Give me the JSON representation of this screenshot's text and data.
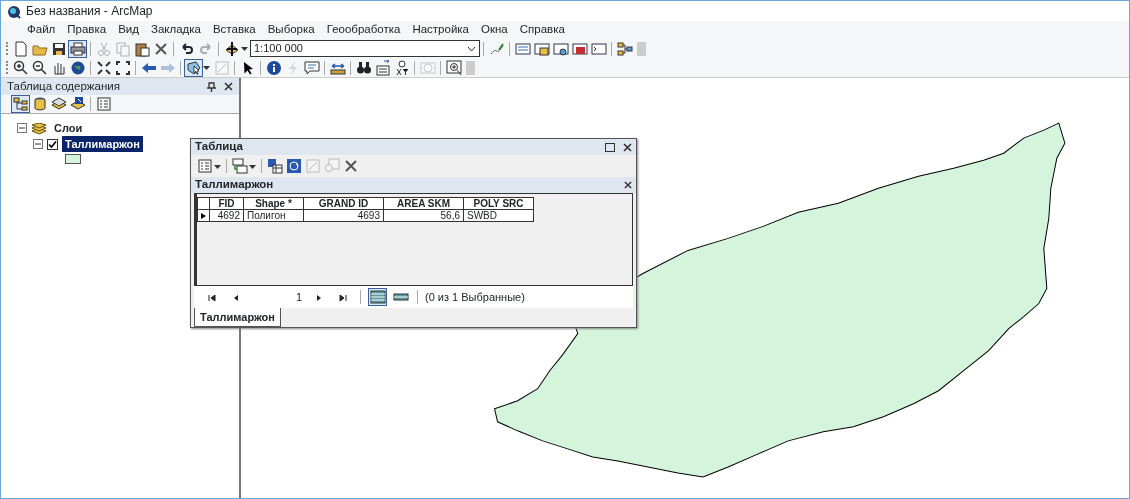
{
  "window": {
    "title": "Без названия - ArcMap"
  },
  "menu": [
    {
      "label": "Файл"
    },
    {
      "label": "Правка"
    },
    {
      "label": "Вид"
    },
    {
      "label": "Закладка"
    },
    {
      "label": "Вставка"
    },
    {
      "label": "Выборка"
    },
    {
      "label": "Геообработка"
    },
    {
      "label": "Настройка"
    },
    {
      "label": "Окна"
    },
    {
      "label": "Справка"
    }
  ],
  "toolbar_1": [
    {
      "kind": "button",
      "disabled": false,
      "selected": false
    },
    {
      "kind": "button",
      "disabled": false,
      "selected": false
    },
    {
      "kind": "button",
      "disabled": false,
      "selected": false
    },
    {
      "kind": "button",
      "disabled": false,
      "selected": true
    },
    {
      "kind": "separator"
    },
    {
      "kind": "button",
      "disabled": true,
      "selected": false
    },
    {
      "kind": "button",
      "disabled": true,
      "selected": false
    },
    {
      "kind": "button",
      "disabled": false,
      "selected": false
    },
    {
      "kind": "button",
      "disabled": false,
      "selected": false
    },
    {
      "kind": "separator"
    },
    {
      "kind": "button",
      "disabled": false,
      "selected": false
    },
    {
      "kind": "button",
      "disabled": true,
      "selected": false
    },
    {
      "kind": "separator"
    },
    {
      "kind": "button",
      "disabled": false,
      "selected": false
    },
    {
      "kind": "scale",
      "value": "1:100 000"
    },
    {
      "kind": "separator"
    },
    {
      "kind": "button",
      "disabled": false,
      "selected": false
    },
    {
      "kind": "separator"
    },
    {
      "kind": "button",
      "disabled": false,
      "selected": false
    },
    {
      "kind": "button",
      "disabled": false,
      "selected": false
    },
    {
      "kind": "button",
      "disabled": false,
      "selected": false
    },
    {
      "kind": "button",
      "disabled": false,
      "selected": false
    },
    {
      "kind": "button",
      "disabled": false,
      "selected": false
    },
    {
      "kind": "separator"
    },
    {
      "kind": "button",
      "disabled": false,
      "selected": false
    }
  ],
  "toolbar_2": [
    {
      "kind": "button",
      "disabled": false,
      "selected": false
    },
    {
      "kind": "button",
      "disabled": false,
      "selected": false
    },
    {
      "kind": "button",
      "disabled": false,
      "selected": false
    },
    {
      "kind": "button",
      "disabled": false,
      "selected": false
    },
    {
      "kind": "separator"
    },
    {
      "kind": "button",
      "disabled": false,
      "selected": false
    },
    {
      "kind": "button",
      "disabled": false,
      "selected": false
    },
    {
      "kind": "separator"
    },
    {
      "kind": "button",
      "disabled": false,
      "selected": false
    },
    {
      "kind": "button",
      "disabled": true,
      "selected": false
    },
    {
      "kind": "separator"
    },
    {
      "kind": "button",
      "disabled": false,
      "selected": true
    },
    {
      "kind": "button",
      "disabled": true,
      "selected": false
    },
    {
      "kind": "separator"
    },
    {
      "kind": "button",
      "disabled": false,
      "selected": false
    },
    {
      "kind": "separator"
    },
    {
      "kind": "button",
      "disabled": false,
      "selected": false
    },
    {
      "kind": "button",
      "disabled": true,
      "selected": false
    },
    {
      "kind": "button",
      "disabled": false,
      "selected": false
    },
    {
      "kind": "separator"
    },
    {
      "kind": "button",
      "disabled": false,
      "selected": false
    },
    {
      "kind": "separator"
    },
    {
      "kind": "button",
      "disabled": false,
      "selected": false
    },
    {
      "kind": "button",
      "disabled": false,
      "selected": false
    },
    {
      "kind": "button",
      "disabled": false,
      "selected": false
    },
    {
      "kind": "separator"
    },
    {
      "kind": "button",
      "disabled": true,
      "selected": false
    },
    {
      "kind": "separator"
    },
    {
      "kind": "button",
      "disabled": false,
      "selected": false
    }
  ],
  "toc": {
    "title": "Таблица содержания",
    "toolbar": [
      {
        "kind": "button",
        "selected": true
      },
      {
        "kind": "button",
        "selected": false
      },
      {
        "kind": "button",
        "selected": false
      },
      {
        "kind": "button",
        "selected": false
      },
      {
        "kind": "separator"
      },
      {
        "kind": "button",
        "selected": false
      }
    ],
    "tree": [
      {
        "label": "Слои",
        "expanded": true,
        "children": [
          {
            "label": "Таллимаржон",
            "expanded": true,
            "checked": true,
            "selected": true
          }
        ]
      }
    ]
  },
  "table_window": {
    "title": "Таблица",
    "tab_title": "Таллимаржон",
    "toolbar": [
      {
        "kind": "button",
        "disabled": false
      },
      {
        "kind": "separator"
      },
      {
        "kind": "button",
        "disabled": false
      },
      {
        "kind": "separator"
      },
      {
        "kind": "button",
        "disabled": false
      },
      {
        "kind": "button",
        "disabled": false
      },
      {
        "kind": "button",
        "disabled": true
      },
      {
        "kind": "button",
        "disabled": true
      },
      {
        "kind": "button",
        "disabled": false
      }
    ],
    "columns": [
      "FID",
      "Shape *",
      "GRAND ID",
      "AREA SKM",
      "POLY SRC"
    ],
    "rows": [
      {
        "current": true,
        "cells": [
          "4692",
          "Полигон",
          "4693",
          "56,6",
          "SWBD"
        ]
      }
    ],
    "record": "1",
    "show_all_selected": true,
    "selection_status": "(0 из 1 Выбранные)",
    "tabs": [
      {
        "label": "Таллимаржон",
        "selected": true
      }
    ]
  }
}
